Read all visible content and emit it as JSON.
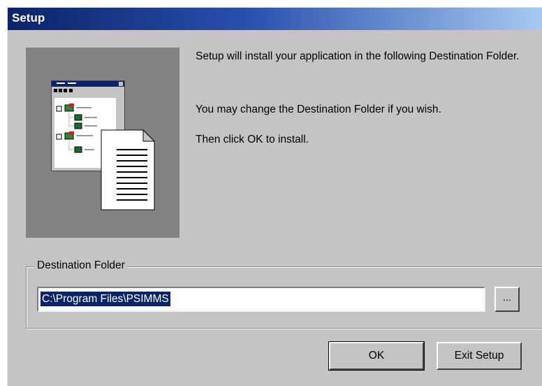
{
  "window": {
    "title": "Setup"
  },
  "messages": {
    "line1": "Setup will install your application in the following Destination Folder.",
    "line2": "You may change the Destination Folder if you wish.",
    "line3": "Then click OK to install."
  },
  "destination": {
    "group_label": "Destination Folder",
    "path_value": "C:\\Program Files\\PSIMMS",
    "browse_label": "..."
  },
  "buttons": {
    "ok_label": "OK",
    "exit_label": "Exit Setup"
  },
  "colors": {
    "title_bar": "#0a246a",
    "dialog_face": "#c6c3c6",
    "selection": "#0a246a"
  }
}
